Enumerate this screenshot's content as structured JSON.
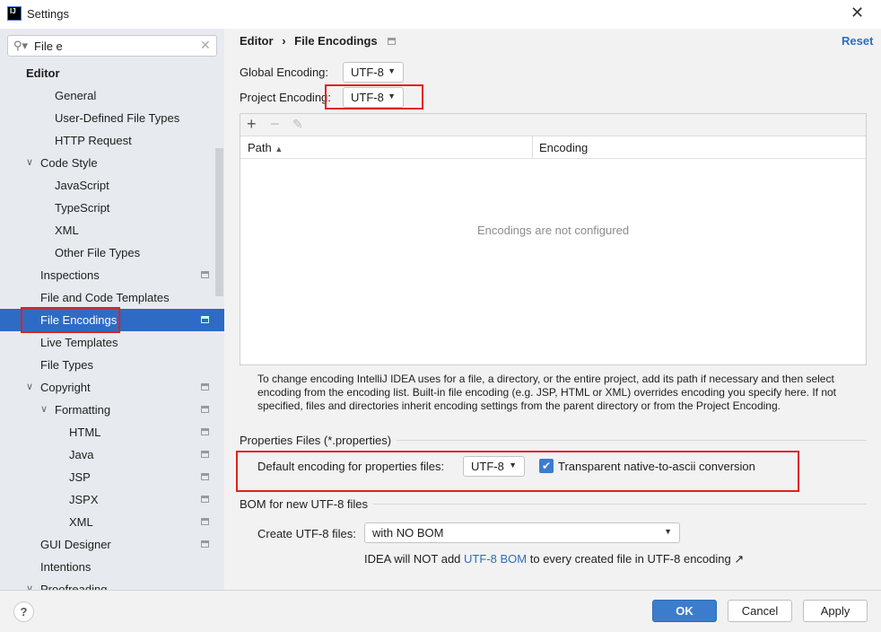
{
  "window": {
    "title": "Settings",
    "app_icon": "IJ"
  },
  "search": {
    "value": "File e"
  },
  "tree": [
    {
      "label": "Editor",
      "level": 0,
      "bold": true
    },
    {
      "label": "General",
      "level": 2
    },
    {
      "label": "User-Defined File Types",
      "level": 2
    },
    {
      "label": "HTTP Request",
      "level": 2
    },
    {
      "label": "Code Style",
      "level": 1,
      "expanded": true
    },
    {
      "label": "JavaScript",
      "level": 2
    },
    {
      "label": "TypeScript",
      "level": 2
    },
    {
      "label": "XML",
      "level": 2
    },
    {
      "label": "Other File Types",
      "level": 2
    },
    {
      "label": "Inspections",
      "level": 1,
      "project": true
    },
    {
      "label": "File and Code Templates",
      "level": 1
    },
    {
      "label": "File Encodings",
      "level": 1,
      "project": true,
      "selected": true
    },
    {
      "label": "Live Templates",
      "level": 1
    },
    {
      "label": "File Types",
      "level": 1
    },
    {
      "label": "Copyright",
      "level": 1,
      "expanded": true,
      "project": true
    },
    {
      "label": "Formatting",
      "level": 2,
      "expanded": true,
      "project": true
    },
    {
      "label": "HTML",
      "level": 3,
      "project": true
    },
    {
      "label": "Java",
      "level": 3,
      "project": true
    },
    {
      "label": "JSP",
      "level": 3,
      "project": true
    },
    {
      "label": "JSPX",
      "level": 3,
      "project": true
    },
    {
      "label": "XML",
      "level": 3,
      "project": true
    },
    {
      "label": "GUI Designer",
      "level": 1,
      "project": true
    },
    {
      "label": "Intentions",
      "level": 1
    },
    {
      "label": "Proofreading",
      "level": 1,
      "expanded": true
    }
  ],
  "breadcrumb": {
    "parent": "Editor",
    "sep": "›",
    "current": "File Encodings"
  },
  "reset": "Reset",
  "global_encoding": {
    "label": "Global Encoding:",
    "value": "UTF-8"
  },
  "project_encoding": {
    "label": "Project Encoding:",
    "value": "UTF-8"
  },
  "table": {
    "columns": [
      "Path",
      "Encoding"
    ],
    "sort": "ascending",
    "empty": "Encodings are not configured"
  },
  "hint": "To change encoding IntelliJ IDEA uses for a file, a directory, or the entire project, add its path if necessary and then select encoding from the encoding list. Built-in file encoding (e.g. JSP, HTML or XML) overrides encoding you specify here. If not specified, files and directories inherit encoding settings from the parent directory or from the Project Encoding.",
  "properties": {
    "section": "Properties Files (*.properties)",
    "label": "Default encoding for properties files:",
    "value": "UTF-8",
    "checkbox_label": "Transparent native-to-ascii conversion",
    "checked": true
  },
  "bom": {
    "section": "BOM for new UTF-8 files",
    "label": "Create UTF-8 files:",
    "value": "with NO BOM",
    "note_pre": "IDEA will NOT add",
    "note_link": "UTF-8 BOM",
    "note_post": "to every created file in UTF-8 encoding ↗"
  },
  "buttons": {
    "ok": "OK",
    "cancel": "Cancel",
    "apply": "Apply",
    "help": "?"
  },
  "colors": {
    "selection": "#2e6bc4",
    "highlight": "#e32020",
    "link": "#2f6dbf"
  }
}
